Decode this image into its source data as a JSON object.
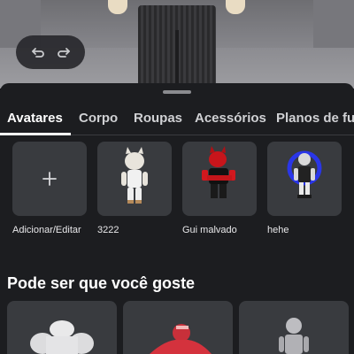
{
  "undo_icon": "undo-icon",
  "redo_icon": "redo-icon",
  "tabs": [
    {
      "label": "Avatares",
      "active": true
    },
    {
      "label": "Corpo",
      "active": false
    },
    {
      "label": "Roupas",
      "active": false
    },
    {
      "label": "Acessórios",
      "active": false
    },
    {
      "label": "Planos de fu",
      "active": false
    }
  ],
  "avatars": [
    {
      "label": "Adicionar/Editar",
      "icon": "plus-icon"
    },
    {
      "label": "3222"
    },
    {
      "label": "Gui malvado"
    },
    {
      "label": "hehe"
    }
  ],
  "suggestions": {
    "title": "Pode ser que você goste",
    "items": [
      "bodybuilder-avatar",
      "red-creature-avatar",
      "gray-avatar"
    ]
  },
  "colors": {
    "sheet_bg": "#1c1d20",
    "tile_bg": "#393b3f",
    "accent": "#ffffff"
  }
}
